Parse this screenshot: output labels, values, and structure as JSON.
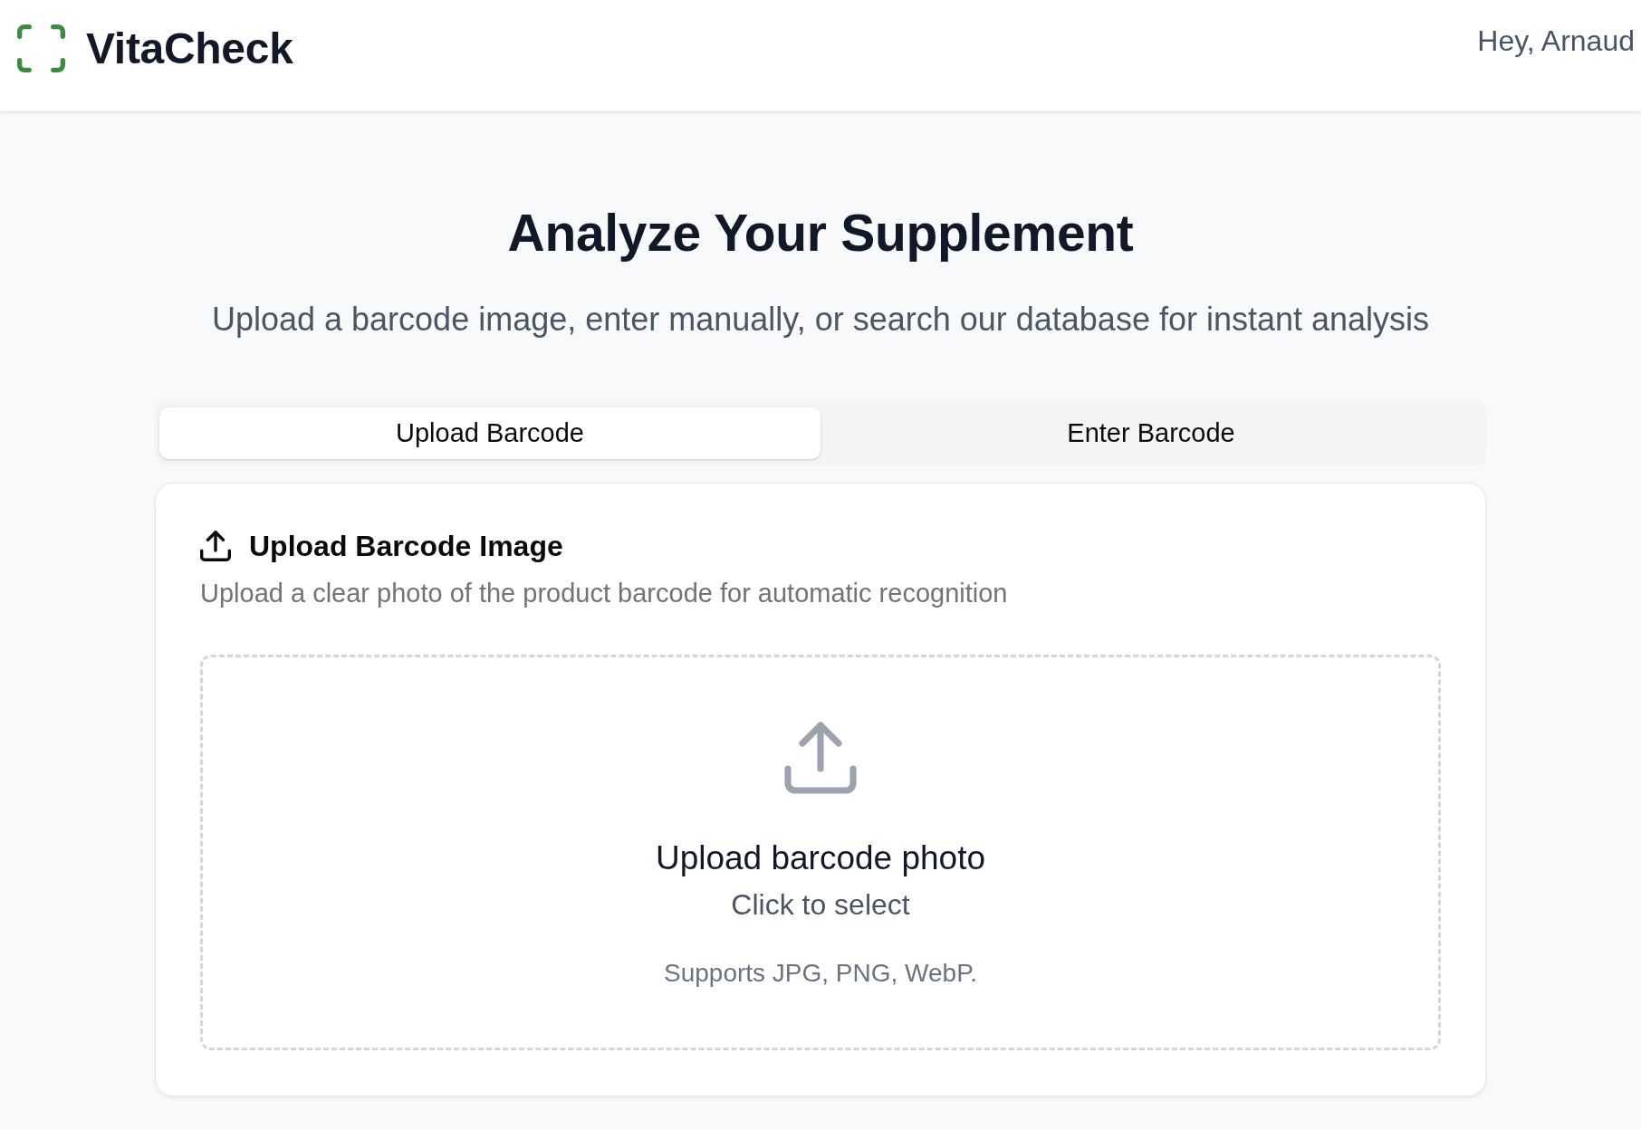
{
  "header": {
    "brand": "VitaCheck",
    "greeting": "Hey, Arnaud"
  },
  "hero": {
    "title": "Analyze Your Supplement",
    "subtitle": "Upload a barcode image, enter manually, or search our database for instant analysis"
  },
  "tabs": [
    {
      "label": "Upload Barcode",
      "selected": true
    },
    {
      "label": "Enter Barcode",
      "selected": false
    }
  ],
  "card": {
    "title": "Upload Barcode Image",
    "description": "Upload a clear photo of the product barcode for automatic recognition",
    "dropzone": {
      "title": "Upload barcode photo",
      "action": "Click to select",
      "formats": "Supports JPG, PNG, WebP."
    }
  }
}
